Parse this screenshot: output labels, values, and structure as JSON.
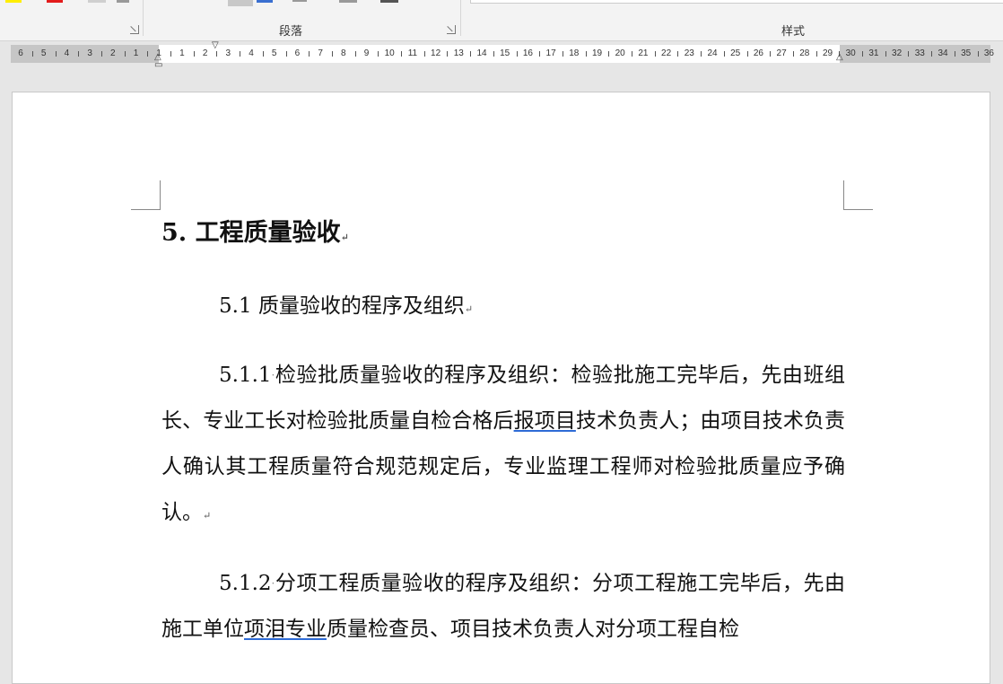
{
  "ribbon": {
    "paragraph_group_label": "段落",
    "styles_group_label": "样式",
    "colors": {
      "highlight": "#ffee00",
      "font_color": "#e31b1b"
    }
  },
  "ruler": {
    "numbers": [
      {
        "label": "6"
      },
      {
        "label": "5"
      },
      {
        "label": "4"
      },
      {
        "label": "3"
      },
      {
        "label": "2"
      },
      {
        "label": "1"
      },
      {
        "label": "1"
      },
      {
        "label": "1"
      },
      {
        "label": "2"
      },
      {
        "label": "3"
      },
      {
        "label": "4"
      },
      {
        "label": "5"
      },
      {
        "label": "6"
      },
      {
        "label": "7"
      },
      {
        "label": "8"
      },
      {
        "label": "9"
      },
      {
        "label": "10"
      },
      {
        "label": "11"
      },
      {
        "label": "12"
      },
      {
        "label": "13"
      },
      {
        "label": "14"
      },
      {
        "label": "15"
      },
      {
        "label": "16"
      },
      {
        "label": "17"
      },
      {
        "label": "18"
      },
      {
        "label": "19"
      },
      {
        "label": "20"
      },
      {
        "label": "21"
      },
      {
        "label": "22"
      },
      {
        "label": "23"
      },
      {
        "label": "24"
      },
      {
        "label": "25"
      },
      {
        "label": "26"
      },
      {
        "label": "27"
      },
      {
        "label": "28"
      },
      {
        "label": "29"
      },
      {
        "label": "30"
      },
      {
        "label": "31"
      },
      {
        "label": "32"
      },
      {
        "label": "33"
      },
      {
        "label": "34"
      },
      {
        "label": "35"
      },
      {
        "label": "36"
      }
    ]
  },
  "document": {
    "heading": "5. 工程质量验收",
    "sub_heading": "5.1 质量验收的程序及组织",
    "paragraph_mark": "↵",
    "p1": {
      "number": "5.1.1",
      "text_a": "检验批质量验收的程序及组织：检验批施工完毕后，先由班组长、专业工长对检验批质量自检合格后",
      "underlined": "报项目",
      "text_b": "技术负责人；由项目技术负责人确认其工程质量符合规范规定后，专业监理工程师对检验批质量应予确认。"
    },
    "p2": {
      "number": "5.1.2",
      "text_a": "分项工程质量验收的程序及组织：分项工程施工完毕后，先由施工单位",
      "underlined": "项泪专业",
      "text_b": "质量检查员、项目技术负责人对分项工程自检"
    }
  }
}
